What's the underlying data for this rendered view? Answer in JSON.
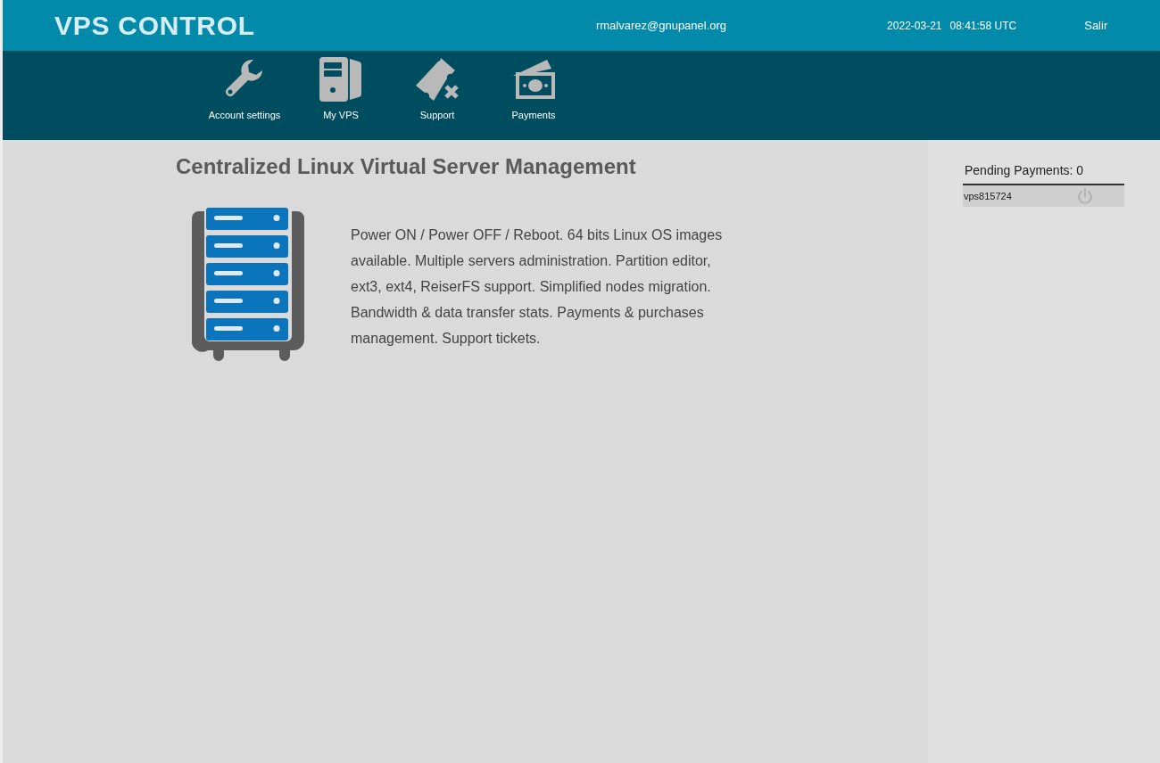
{
  "header": {
    "title": "VPS CONTROL",
    "email": "rmalvarez@gnupanel.org",
    "date": "2022-03-21",
    "time": "08:41:58 UTC",
    "logout": "Salir"
  },
  "nav": [
    {
      "kind": "wrench",
      "label": "Account settings"
    },
    {
      "kind": "computer",
      "label": "My VPS"
    },
    {
      "kind": "ticket",
      "label": "Support"
    },
    {
      "kind": "money",
      "label": "Payments"
    }
  ],
  "main": {
    "heading": "Centralized Linux Virtual Server Management",
    "description": "Power ON / Power OFF / Reboot. 64 bits Linux OS images available. Multiple servers administration. Partition editor, ext3, ext4, ReiserFS support. Simplified nodes migration. Bandwidth & data transfer stats. Payments & purchases management. Support tickets."
  },
  "sidebar": {
    "title": "Pending Payments: 0",
    "servers": [
      {
        "name": "vps815724"
      }
    ]
  }
}
